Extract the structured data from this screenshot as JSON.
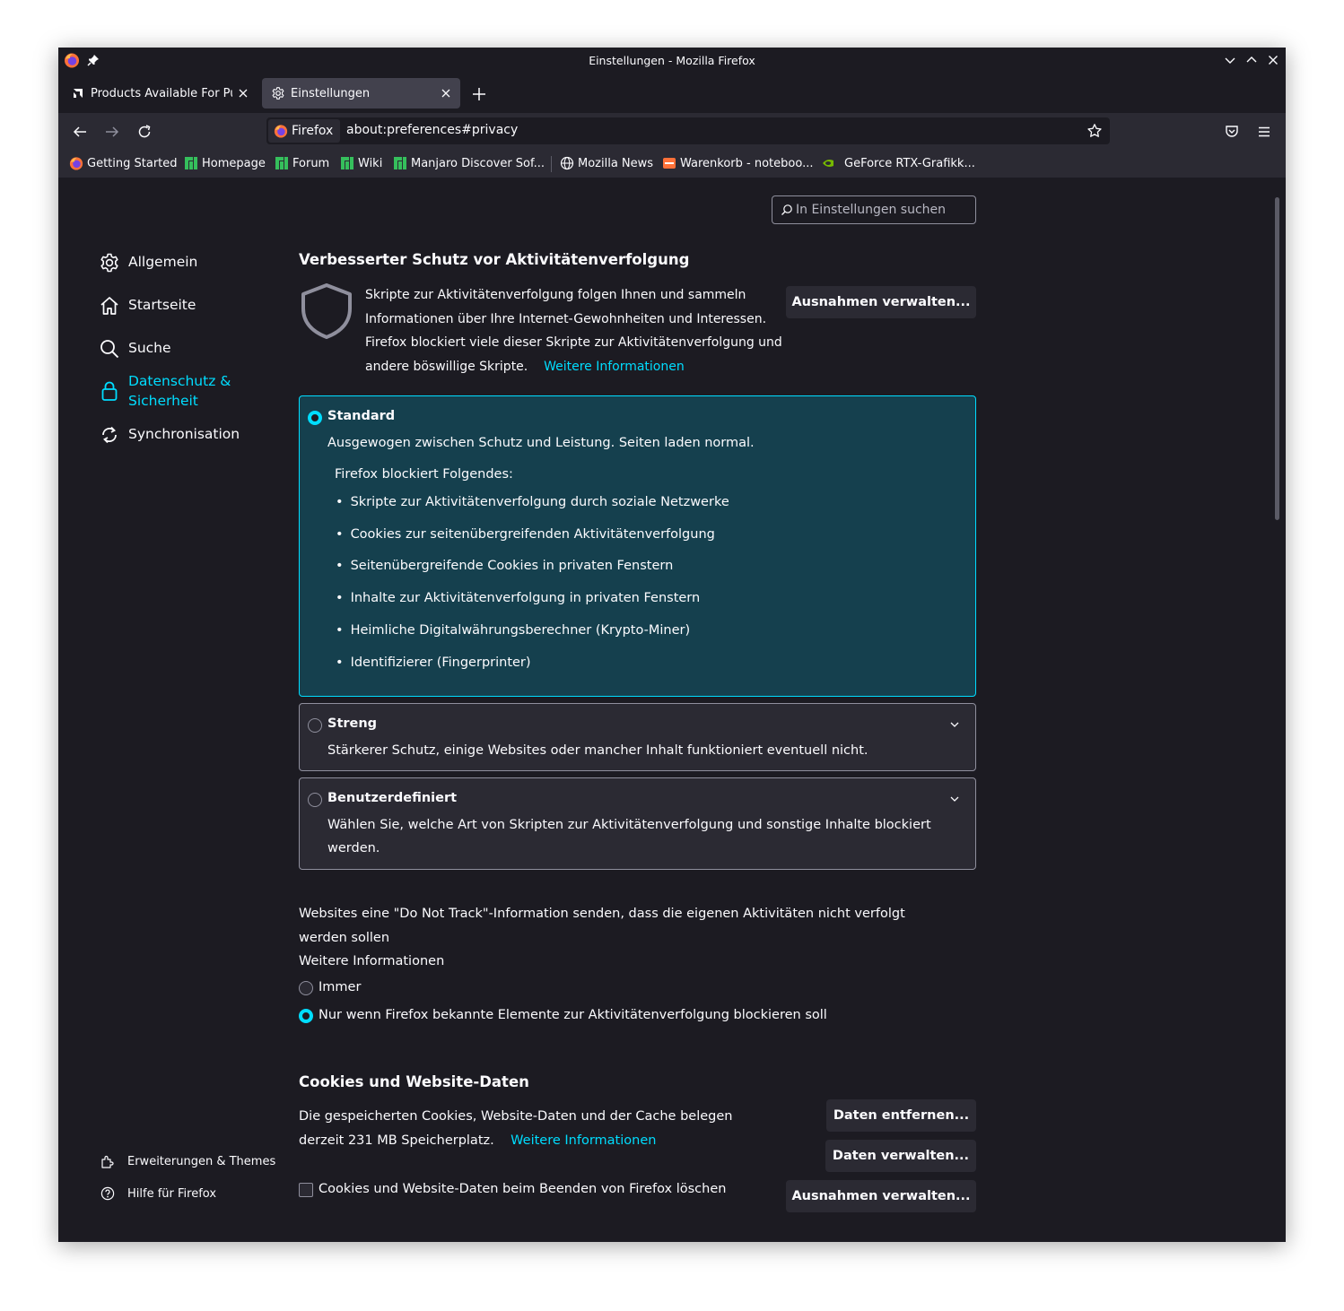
{
  "window": {
    "title": "Einstellungen - Mozilla Firefox"
  },
  "tabs": [
    {
      "label": "Products Available For Purchase",
      "active": false
    },
    {
      "label": "Einstellungen",
      "active": true
    }
  ],
  "urlbar": {
    "identity_label": "Firefox",
    "url": "about:preferences#privacy"
  },
  "bookmarks": [
    {
      "label": "Getting Started",
      "icon": "firefox-icon"
    },
    {
      "label": "Homepage",
      "icon": "manjaro-icon"
    },
    {
      "label": "Forum",
      "icon": "manjaro-icon"
    },
    {
      "label": "Wiki",
      "icon": "manjaro-icon"
    },
    {
      "label": "Manjaro Discover Sof...",
      "icon": "manjaro-icon"
    },
    {
      "label": "Mozilla News",
      "icon": "globe-icon"
    },
    {
      "label": "Warenkorb - noteboo...",
      "icon": "shop-icon"
    },
    {
      "label": "GeForce RTX-Grafikk...",
      "icon": "nvidia-icon"
    }
  ],
  "search": {
    "placeholder": "In Einstellungen suchen"
  },
  "sidebar": {
    "categories": [
      {
        "label": "Allgemein",
        "icon": "gear-icon"
      },
      {
        "label": "Startseite",
        "icon": "home-icon"
      },
      {
        "label": "Suche",
        "icon": "search-icon"
      },
      {
        "label_line1": "Datenschutz &",
        "label_line2": "Sicherheit",
        "icon": "lock-icon",
        "selected": true
      },
      {
        "label": "Synchronisation",
        "icon": "sync-icon"
      }
    ],
    "footer": [
      {
        "label": "Erweiterungen & Themes",
        "icon": "puzzle-icon"
      },
      {
        "label": "Hilfe für Firefox",
        "icon": "help-icon"
      }
    ]
  },
  "etp": {
    "heading": "Verbesserter Schutz vor Aktivitätenverfolgung",
    "description": "Skripte zur Aktivitätenverfolgung folgen Ihnen und sammeln Informationen über Ihre Internet-Gewohnheiten und Interessen. Firefox blockiert viele dieser Skripte zur Aktivitätenverfolgung und andere böswillige Skripte.",
    "learn_more": "Weitere Informationen",
    "exceptions_button": "Ausnahmen verwalten...",
    "standard": {
      "title": "Standard",
      "description": "Ausgewogen zwischen Schutz und Leistung. Seiten laden normal.",
      "blocks_title": "Firefox blockiert Folgendes:",
      "blocks": [
        "Skripte zur Aktivitätenverfolgung durch soziale Netzwerke",
        "Cookies zur seitenübergreifenden Aktivitätenverfolgung",
        "Seitenübergreifende Cookies in privaten Fenstern",
        "Inhalte zur Aktivitätenverfolgung in privaten Fenstern",
        "Heimliche Digitalwährungsberechner (Krypto-Miner)",
        "Identifizierer (Fingerprinter)"
      ]
    },
    "strict": {
      "title": "Streng",
      "description": "Stärkerer Schutz, einige Websites oder mancher Inhalt funktioniert eventuell nicht."
    },
    "custom": {
      "title": "Benutzerdefiniert",
      "description": "Wählen Sie, welche Art von Skripten zur Aktivitätenverfolgung und sonstige Inhalte blockiert werden."
    }
  },
  "dnt": {
    "description": "Websites eine \"Do Not Track\"-Information senden, dass die eigenen Aktivitäten nicht verfolgt werden sollen",
    "learn_more": "Weitere Informationen",
    "option_always": "Immer",
    "option_only": "Nur wenn Firefox bekannte Elemente zur Aktivitätenverfolgung blockieren soll"
  },
  "cookies": {
    "heading": "Cookies und Website-Daten",
    "description": "Die gespeicherten Cookies, Website-Daten und der Cache belegen derzeit 231 MB Speicherplatz.",
    "learn_more": "Weitere Informationen",
    "clear_button": "Daten entfernen...",
    "manage_button": "Daten verwalten...",
    "exceptions_button": "Ausnahmen verwalten...",
    "delete_on_close": "Cookies und Website-Daten beim Beenden von Firefox löschen"
  },
  "colors": {
    "accent": "#00ddff",
    "background": "#1c1b22",
    "selected_option": "#15404e"
  }
}
